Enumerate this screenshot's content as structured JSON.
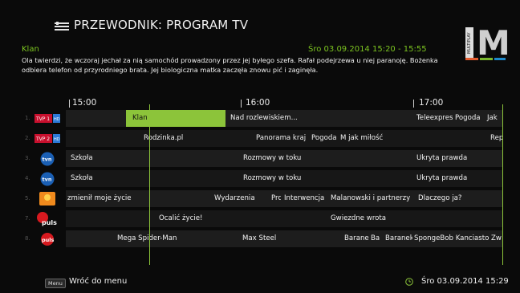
{
  "header": {
    "title": "PRZEWODNIK: PROGRAM TV",
    "logo_letter": "M",
    "logo_vertical": "MULTIPLAY"
  },
  "info": {
    "program_title": "Klan",
    "datetime": "Śro 03.09.2014 15:20 - 15:55",
    "description": "Ola twierdzi, że wczoraj jechał za nią samochód prowadzony przez jej byłego szefa. Rafał podejrzewa u niej paranoję. Bożenka odbiera telefon od przyrodniego brata. Jej biologiczna matka zaczęła znowu pić i zaginęła."
  },
  "timeline": {
    "labels": [
      "15:00",
      "16:00",
      "17:00"
    ]
  },
  "channels": [
    {
      "num": "1.",
      "logo": "TVP 1 HD",
      "programs": [
        "Klan",
        "Nad rozlewiskiem...",
        "Teleexpress",
        "Pogoda",
        "Jak"
      ]
    },
    {
      "num": "2.",
      "logo": "TVP 2 HD",
      "programs": [
        "Rodzinka.pl",
        "Panorama kraj",
        "Pogoda",
        "M jak miłość",
        "Rep"
      ]
    },
    {
      "num": "3.",
      "logo": "tvn HD",
      "programs": [
        "Szkoła",
        "Rozmowy w toku",
        "Ukryta prawda"
      ]
    },
    {
      "num": "4.",
      "logo": "tvn",
      "programs": [
        "Szkoła",
        "Rozmowy w toku",
        "Ukryta prawda"
      ]
    },
    {
      "num": "5.",
      "logo": "Polsat",
      "programs": "zmienił moje życie|Wydarzenia|Prc|Interwencja|Malanowski i partnerzy|Dlaczego ja?"
    },
    {
      "num": "7.",
      "logo": "TV puls",
      "programs": [
        "Ocalić życie!",
        "Gwiezdne wrota"
      ]
    },
    {
      "num": "8.",
      "logo": "puls 2",
      "programs": [
        "Mega Spider-Man",
        "Max Steel",
        "Baranek",
        "Ba",
        "Baranek",
        "SpongeBob Kanciastoporty",
        "Zw"
      ]
    }
  ],
  "footer": {
    "menu_key": "Menu",
    "menu_label": "Wróć do menu",
    "clock": "Śro 03.09.2014 15:29"
  },
  "colors": {
    "accent": "#8cc43a",
    "background": "#0a0a0a",
    "row": "#1d1d1d"
  }
}
